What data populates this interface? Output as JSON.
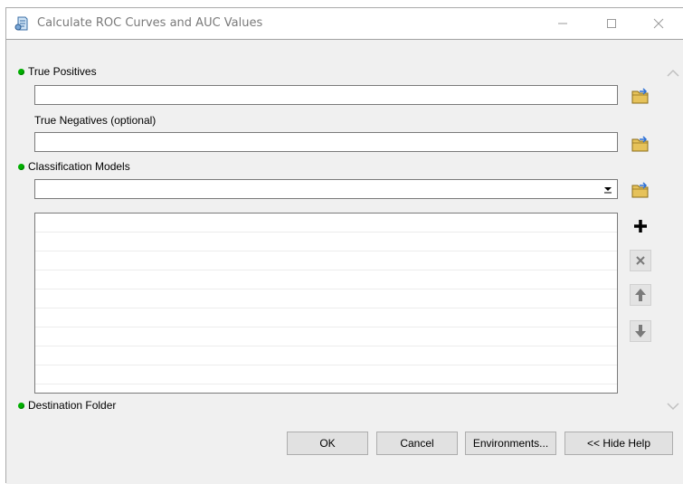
{
  "window": {
    "title": "Calculate ROC Curves and AUC Values",
    "controls": {
      "minimize": "—",
      "maximize": "☐",
      "close": "✕"
    }
  },
  "params": {
    "true_positives": {
      "label": "True Positives",
      "value": "",
      "required": true
    },
    "true_negatives": {
      "label": "True Negatives (optional)",
      "value": "",
      "required": false
    },
    "classification_models": {
      "label": "Classification Models",
      "value": "",
      "required": true,
      "items": []
    },
    "destination_folder": {
      "label": "Destination Folder",
      "value": "",
      "required": true
    }
  },
  "list_buttons": {
    "add": "+",
    "remove": "×",
    "up": "↑",
    "down": "↓"
  },
  "footer": {
    "ok": "OK",
    "cancel": "Cancel",
    "environments": "Environments...",
    "hide_help": "<< Hide Help"
  },
  "colors": {
    "required_dot": "#00b000",
    "folder_icon": "#e6c25a"
  }
}
